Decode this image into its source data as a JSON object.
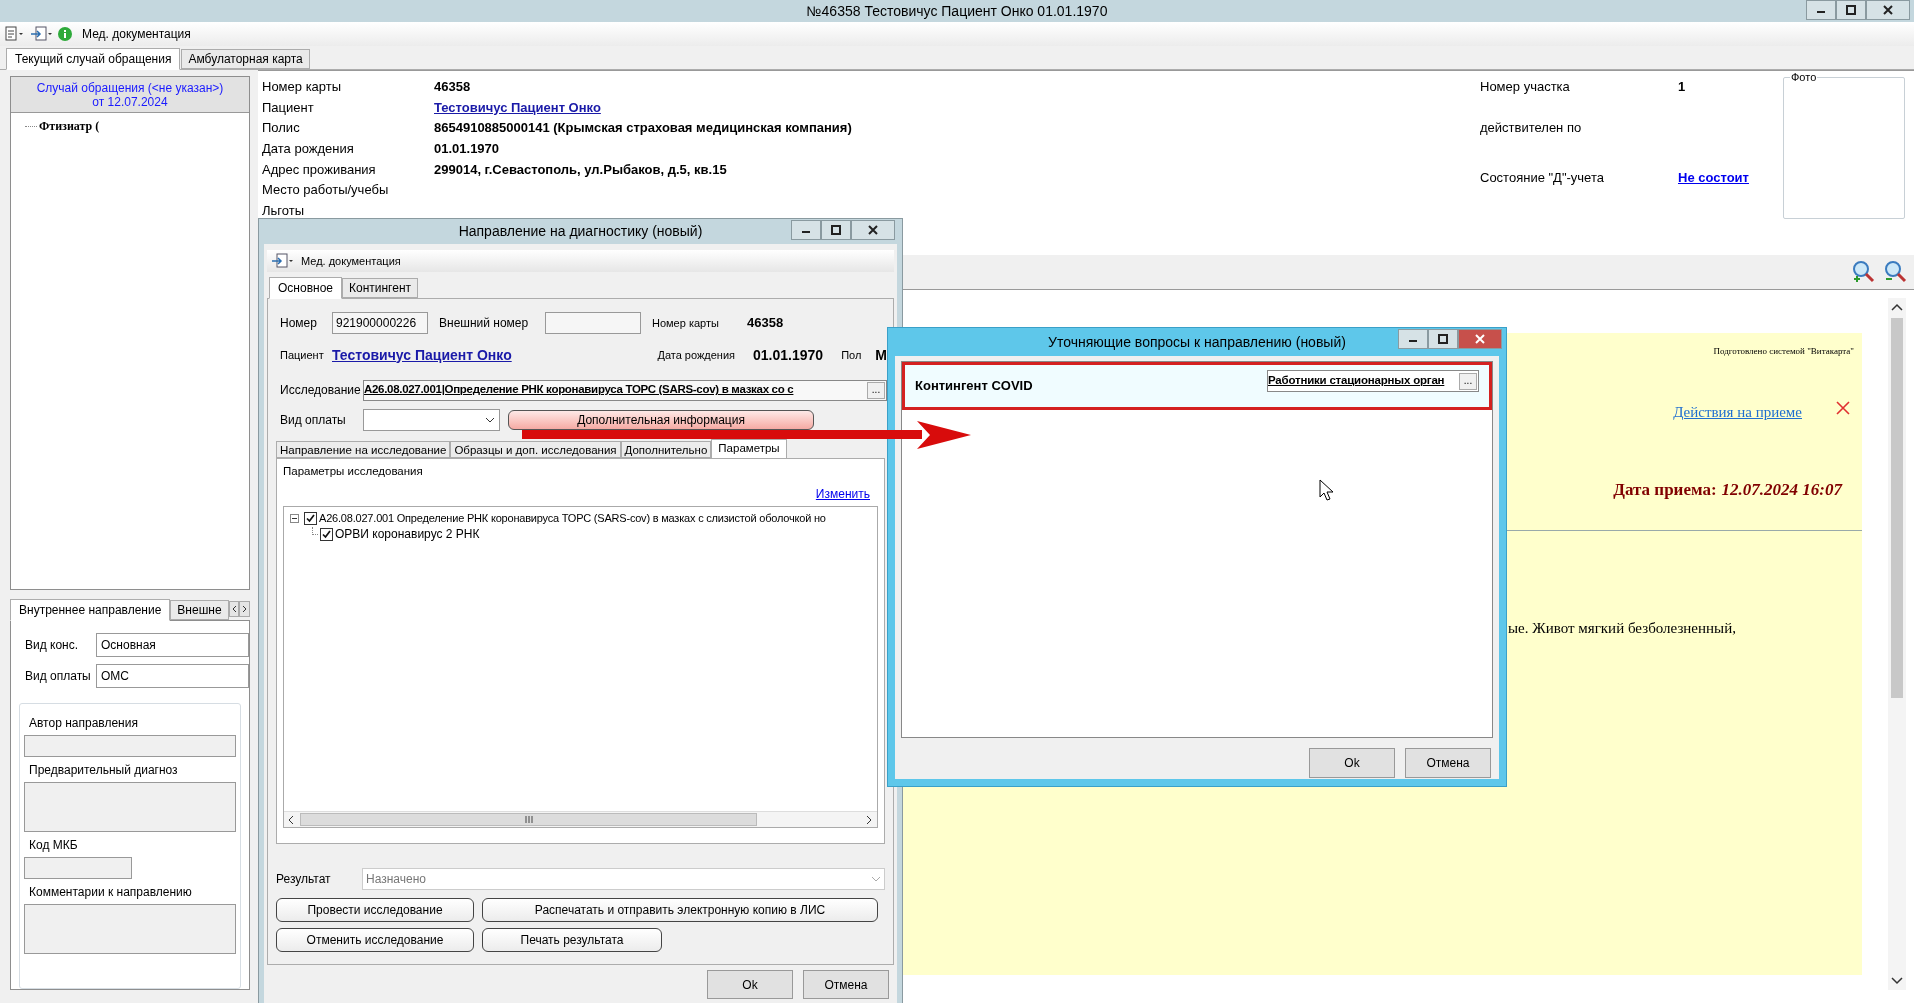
{
  "window": {
    "title": "№46358 Тестовичус Пациент Онко 01.01.1970"
  },
  "toolbar": {
    "label": "Мед. документация"
  },
  "tabs": [
    {
      "label": "Текущий случай обращения",
      "selected": true
    },
    {
      "label": "Амбулаторная карта",
      "selected": false
    }
  ],
  "case_panel": {
    "header": "Случай обращения (<не указан>)",
    "date": "от 12.07.2024",
    "tree": [
      {
        "label": "Фтизиатр ("
      }
    ]
  },
  "referral_panel": {
    "tabs": [
      {
        "label": "Внутреннее направление",
        "selected": true
      },
      {
        "label": "Внешне",
        "selected": false
      }
    ],
    "fields": [
      {
        "label": "Вид конс.",
        "value": "Основная"
      },
      {
        "label": "Вид оплаты",
        "value": "ОМС"
      }
    ],
    "sections": [
      {
        "label": "Автор направления",
        "kind": "line"
      },
      {
        "label": "Предварительный диагноз",
        "kind": "area"
      },
      {
        "label": "Код МКБ",
        "kind": "short"
      },
      {
        "label": "Комментарии к направлению",
        "kind": "area"
      }
    ]
  },
  "patient_info": [
    {
      "label": "Номер карты",
      "value": "46358",
      "kind": "bold"
    },
    {
      "label": "Пациент",
      "value": "Тестовичус Пациент Онко",
      "kind": "link"
    },
    {
      "label": "Полис",
      "value": "8654910885000141 (Крымская страховая медицинская компания)",
      "kind": "bold"
    },
    {
      "label": "Дата рождения",
      "value": "01.01.1970",
      "kind": "bold"
    },
    {
      "label": "Адрес проживания",
      "value": "299014, г.Севастополь, ул.Рыбаков, д.5, кв.15",
      "kind": "bold"
    },
    {
      "label": "Место работы/учебы"
    },
    {
      "label": "Льготы"
    }
  ],
  "district": [
    {
      "label": "Номер участка",
      "value": "1",
      "kind": "bold"
    },
    {
      "label": "действителен по"
    },
    {
      "label": "Состояние \"Д\"-учета",
      "value": "Не состоит",
      "kind": "link"
    }
  ],
  "photo": {
    "label": "Фото"
  },
  "document": {
    "note": "Подготовлено системой \"Витакарта\"",
    "actions_link": "Действия на приеме",
    "date_label": "Дата приема:",
    "date_value": "12.07.2024 16:07",
    "text": "ые. Живот мягкий безболезненный,"
  },
  "diagnostic_dialog": {
    "title": "Направление на диагностику (новый)",
    "toolbar_label": "Мед. документация",
    "tabs": [
      {
        "label": "Основное",
        "selected": true
      },
      {
        "label": "Контингент",
        "selected": false
      }
    ],
    "number_label": "Номер",
    "number": "921900000226",
    "external_label": "Внешний номер",
    "card_label": "Номер карты",
    "card": "46358",
    "patient_label": "Пациент",
    "patient": "Тестовичус Пациент Онко",
    "birth_label": "Дата рождения",
    "birth": "01.01.1970",
    "sex_label": "Пол",
    "sex": "М",
    "study_label": "Исследование",
    "study": "A26.08.027.001|Определение РНК коронавируса ТОРС (SARS-cov) в мазках со с",
    "browse_label": "...",
    "payment_label": "Вид оплаты",
    "extra_button": "Дополнительная информация",
    "subtabs": [
      {
        "label": "Направление на исследование",
        "selected": false
      },
      {
        "label": "Образцы и доп. исследования",
        "selected": false
      },
      {
        "label": "Дополнительно",
        "selected": false
      },
      {
        "label": "Параметры",
        "selected": true
      }
    ],
    "group_label": "Параметры исследования",
    "change_link": "Изменить",
    "tree": [
      {
        "label": "A26.08.027.001 Определение РНК коронавируса ТОРС (SARS-cov) в мазках с слизистой оболочкой но",
        "checked": true,
        "expanded": true,
        "children": [
          {
            "label": "ОРВИ коронавирус 2 РНК",
            "checked": true
          }
        ]
      }
    ],
    "result_label": "Результат",
    "result": "Назначено",
    "actions": [
      "Провести исследование",
      "Распечатать и отправить электронную копию в ЛИС",
      "Отменить исследование",
      "Печать результата"
    ],
    "ok": "Ok",
    "cancel": "Отмена"
  },
  "questions_dialog": {
    "title": "Уточняющие вопросы к направлению (новый)",
    "questions": [
      {
        "label": "Контингент COVID",
        "value": "Работники стационарных орган",
        "highlighted": true,
        "browse_label": "..."
      }
    ],
    "ok": "Ok",
    "cancel": "Отмена"
  }
}
